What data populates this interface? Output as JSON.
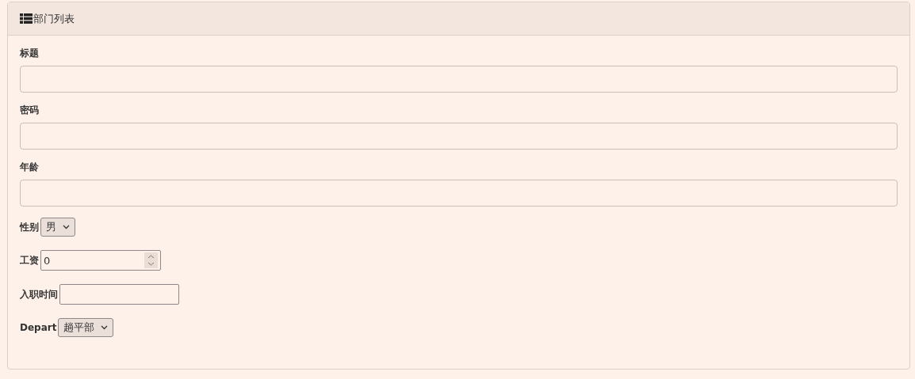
{
  "panel": {
    "title": "部门列表"
  },
  "fields": [
    {
      "kind": "text",
      "label": "标题"
    },
    {
      "kind": "text",
      "label": "密码"
    },
    {
      "kind": "text",
      "label": "年龄"
    },
    {
      "kind": "select",
      "label": "性别",
      "value": "男"
    },
    {
      "kind": "number",
      "label": "工资",
      "value": "0"
    },
    {
      "kind": "date",
      "label": "入职时间"
    },
    {
      "kind": "select",
      "label": "Depart",
      "value": "趟平部"
    }
  ]
}
